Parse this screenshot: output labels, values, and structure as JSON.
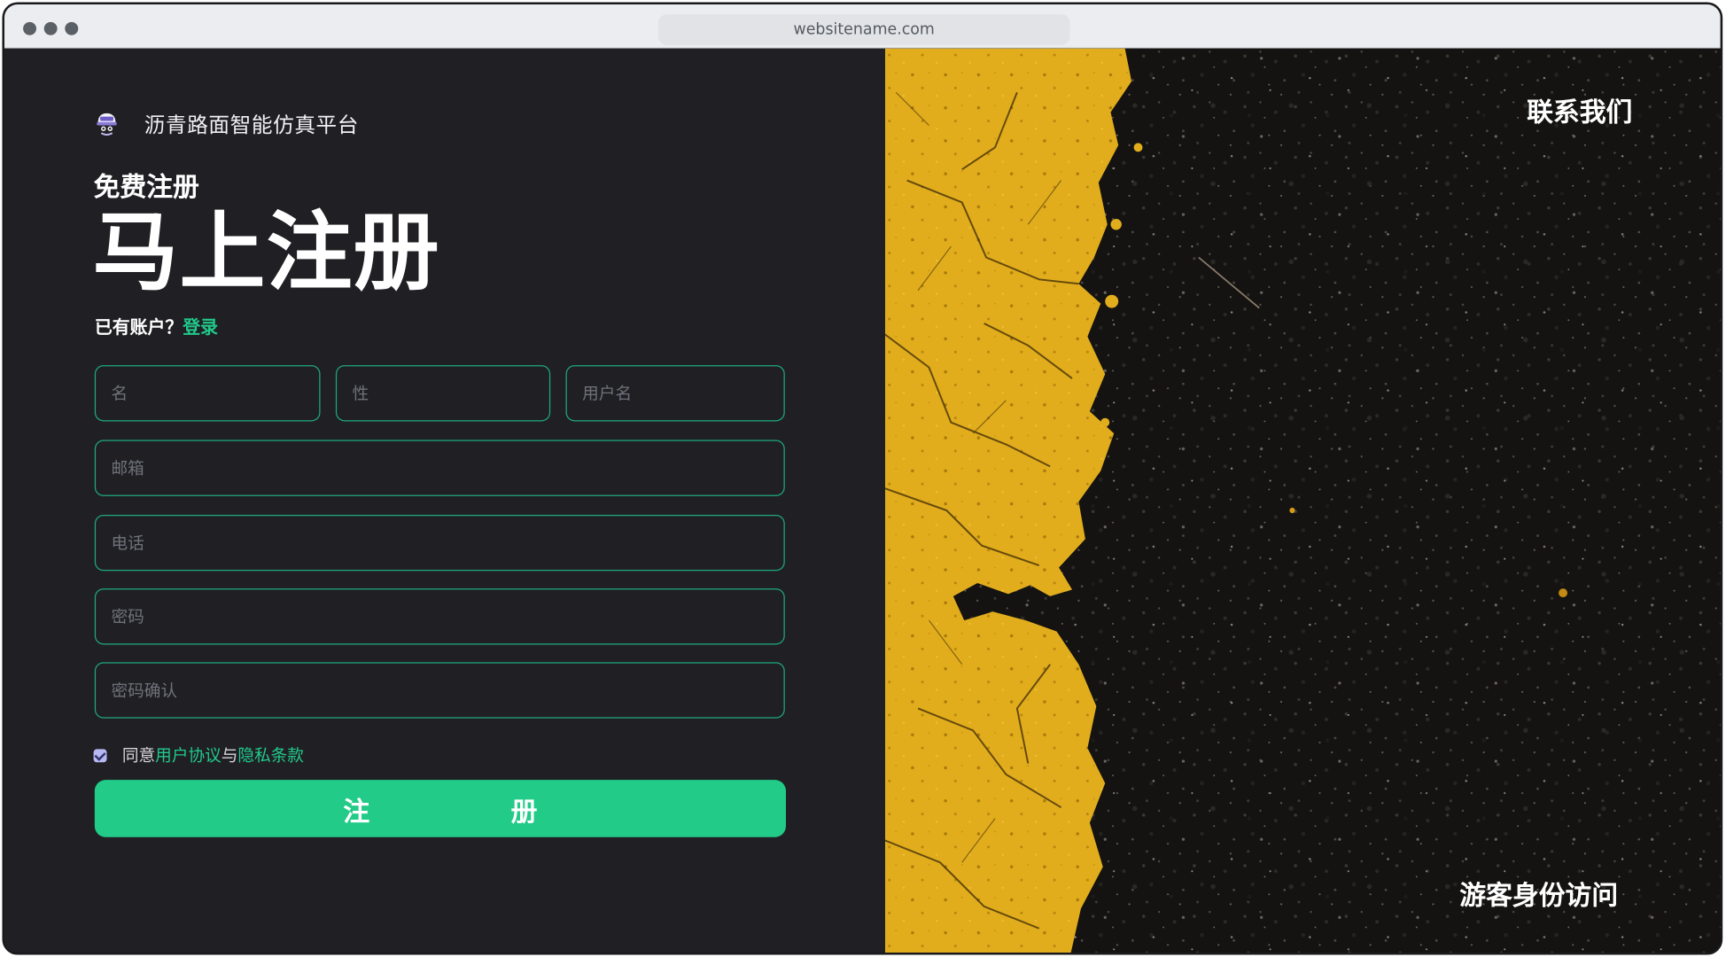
{
  "browser": {
    "url": "websitename.com"
  },
  "brand": {
    "logo_icon": "hardhat-mascot-icon",
    "name": "沥青路面智能仿真平台"
  },
  "register": {
    "subtitle": "免费注册",
    "headline": "马上注册",
    "have_account": "已有账户？",
    "login_link": "登录",
    "fields": {
      "first_name_placeholder": "名",
      "last_name_placeholder": "性",
      "username_placeholder": "用户名",
      "email_placeholder": "邮箱",
      "phone_placeholder": "电话",
      "password_placeholder": "密码",
      "password_confirm_placeholder": "密码确认"
    },
    "agree": {
      "checked": true,
      "prefix": "同意",
      "user_agreement": "用户协议",
      "and": "与",
      "privacy_policy": "隐私条款"
    },
    "submit_label": "注 册"
  },
  "hero": {
    "image": "asphalt-road-yellow-marking",
    "contact_label": "联系我们",
    "guest_label": "游客身份访问"
  },
  "colors": {
    "accent": "#22cb88",
    "link": "#20c98b",
    "background": "#202024",
    "input_border": "#1fa87a"
  }
}
